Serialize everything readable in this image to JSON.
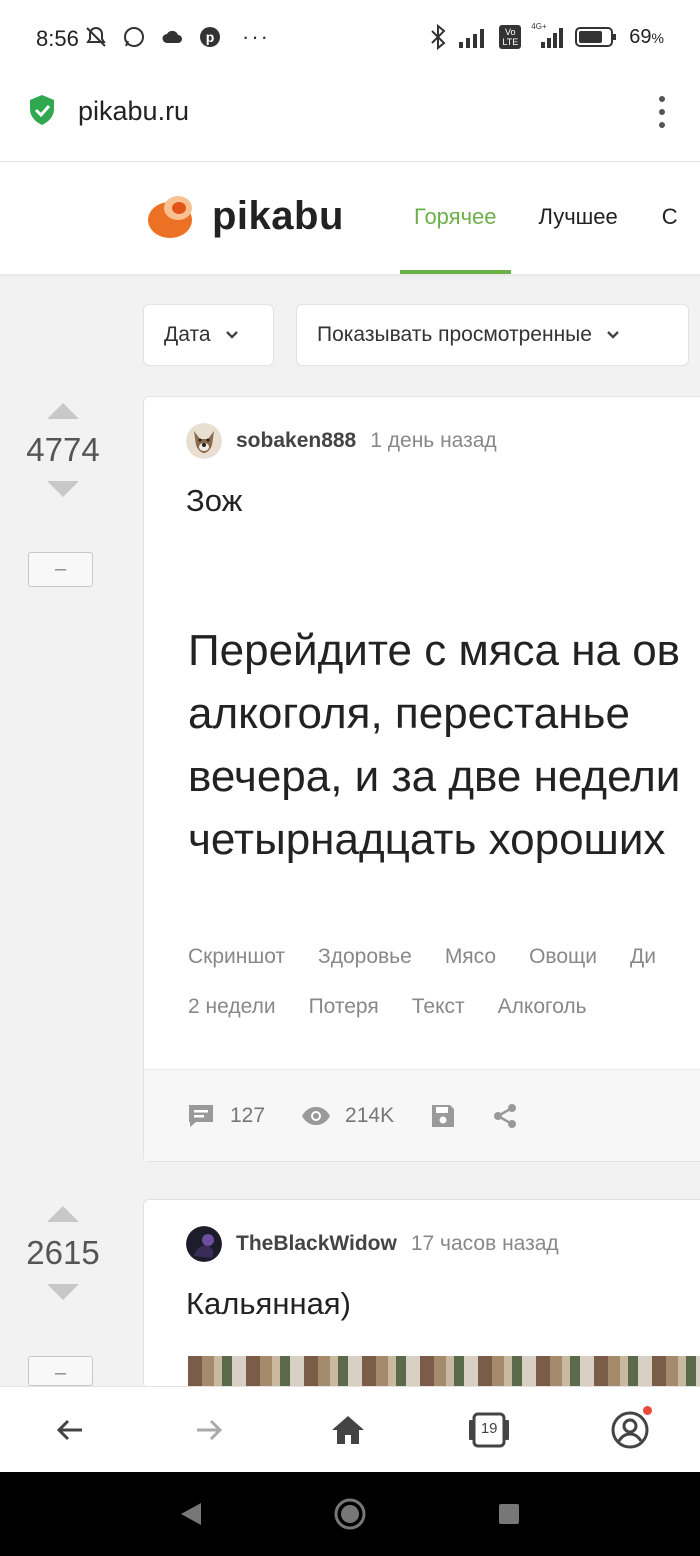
{
  "status_bar": {
    "time": "8:56",
    "battery": "69",
    "battery_suffix": "%",
    "more": "···",
    "network": "4G+",
    "volte": "Vo LTE"
  },
  "url_bar": {
    "url": "pikabu.ru"
  },
  "site": {
    "logo_text": "pikabu",
    "brand_color": "#6db04a",
    "nav": [
      {
        "label": "Горячее",
        "active": true
      },
      {
        "label": "Лучшее",
        "active": false
      },
      {
        "label": "С",
        "active": false
      }
    ]
  },
  "filters": {
    "date_label": "Дата",
    "viewed_label": "Показывать просмотренные"
  },
  "posts": [
    {
      "rating": "4774",
      "minus": "–",
      "author": "sobaken888",
      "time": "1 день назад",
      "title": "Зож",
      "body_lines": [
        "Перейдите с мяса на ов",
        "алкоголя, перестанье",
        "вечера, и за две недели",
        "четырнадцать хороших"
      ],
      "tags_line1": [
        "Скриншот",
        "Здоровье",
        "Мясо",
        "Овощи",
        "Ди"
      ],
      "tags_line2": [
        "2 недели",
        "Потеря",
        "Текст",
        "Алкоголь"
      ],
      "comments": "127",
      "views": "214K"
    },
    {
      "rating": "2615",
      "minus": "–",
      "author": "TheBlackWidow",
      "time": "17 часов назад",
      "title": "Кальянная)"
    }
  ],
  "bottom_bar": {
    "tabs_count": "19"
  }
}
